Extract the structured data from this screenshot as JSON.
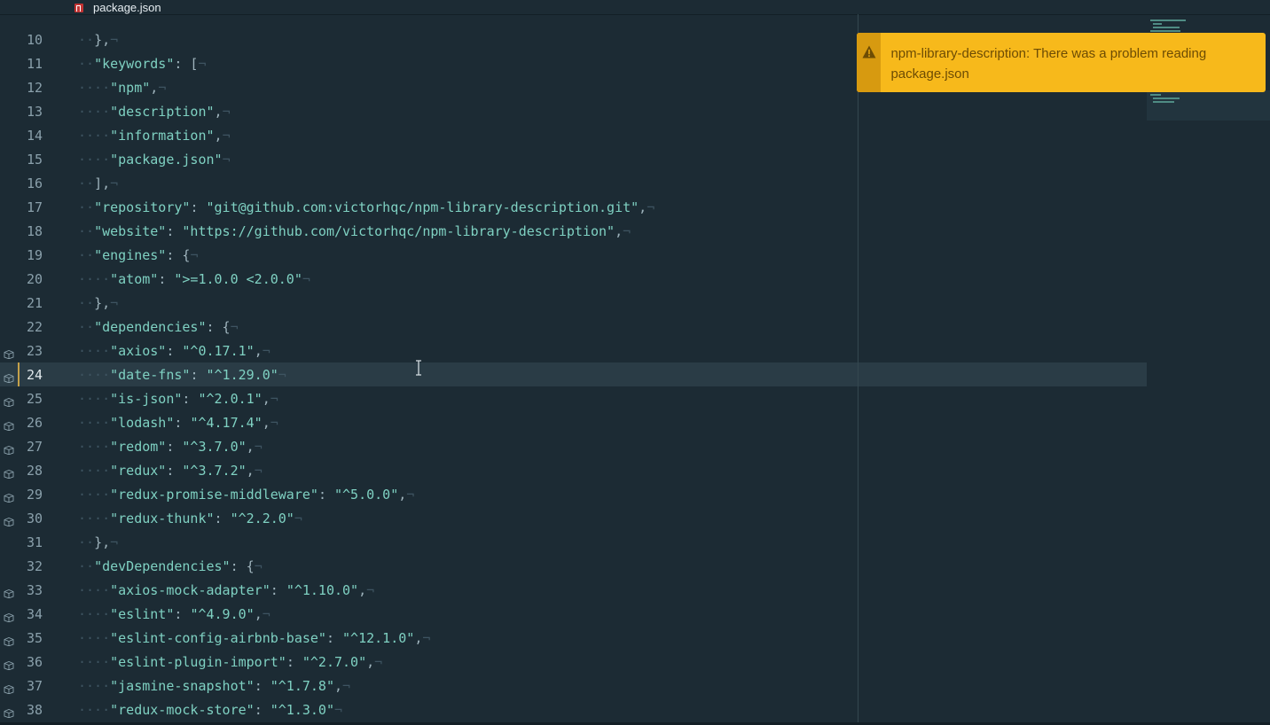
{
  "tab": {
    "title": "package.json",
    "icon": "npm-icon"
  },
  "notification": {
    "type": "warning",
    "icon": "warning-icon",
    "message": "npm-library-description: There was a problem reading package.json",
    "colors": {
      "background": "#f7b91b",
      "strip": "#d79a10",
      "text": "#6d4c04"
    }
  },
  "editor": {
    "active_line": 24,
    "lines": [
      {
        "num": "10",
        "indent": 1,
        "text": "},",
        "dep": false
      },
      {
        "num": "11",
        "indent": 1,
        "text": "\"keywords\": [",
        "dep": false
      },
      {
        "num": "12",
        "indent": 2,
        "text": "\"npm\",",
        "dep": false
      },
      {
        "num": "13",
        "indent": 2,
        "text": "\"description\",",
        "dep": false
      },
      {
        "num": "14",
        "indent": 2,
        "text": "\"information\",",
        "dep": false
      },
      {
        "num": "15",
        "indent": 2,
        "text": "\"package.json\"",
        "dep": false
      },
      {
        "num": "16",
        "indent": 1,
        "text": "],",
        "dep": false
      },
      {
        "num": "17",
        "indent": 1,
        "text": "\"repository\": \"git@github.com:victorhqc/npm-library-description.git\",",
        "dep": false
      },
      {
        "num": "18",
        "indent": 1,
        "text": "\"website\": \"https://github.com/victorhqc/npm-library-description\",",
        "dep": false
      },
      {
        "num": "19",
        "indent": 1,
        "text": "\"engines\": {",
        "dep": false
      },
      {
        "num": "20",
        "indent": 2,
        "text": "\"atom\": \">=1.0.0 <2.0.0\"",
        "dep": false
      },
      {
        "num": "21",
        "indent": 1,
        "text": "},",
        "dep": false
      },
      {
        "num": "22",
        "indent": 1,
        "text": "\"dependencies\": {",
        "dep": false
      },
      {
        "num": "23",
        "indent": 2,
        "text": "\"axios\": \"^0.17.1\",",
        "dep": true
      },
      {
        "num": "24",
        "indent": 2,
        "text": "\"date-fns\": \"^1.29.0\"",
        "dep": true
      },
      {
        "num": "25",
        "indent": 2,
        "text": "\"is-json\": \"^2.0.1\",",
        "dep": true
      },
      {
        "num": "26",
        "indent": 2,
        "text": "\"lodash\": \"^4.17.4\",",
        "dep": true
      },
      {
        "num": "27",
        "indent": 2,
        "text": "\"redom\": \"^3.7.0\",",
        "dep": true
      },
      {
        "num": "28",
        "indent": 2,
        "text": "\"redux\": \"^3.7.2\",",
        "dep": true
      },
      {
        "num": "29",
        "indent": 2,
        "text": "\"redux-promise-middleware\": \"^5.0.0\",",
        "dep": true
      },
      {
        "num": "30",
        "indent": 2,
        "text": "\"redux-thunk\": \"^2.2.0\"",
        "dep": true
      },
      {
        "num": "31",
        "indent": 1,
        "text": "},",
        "dep": false
      },
      {
        "num": "32",
        "indent": 1,
        "text": "\"devDependencies\": {",
        "dep": false
      },
      {
        "num": "33",
        "indent": 2,
        "text": "\"axios-mock-adapter\": \"^1.10.0\",",
        "dep": true
      },
      {
        "num": "34",
        "indent": 2,
        "text": "\"eslint\": \"^4.9.0\",",
        "dep": true
      },
      {
        "num": "35",
        "indent": 2,
        "text": "\"eslint-config-airbnb-base\": \"^12.1.0\",",
        "dep": true
      },
      {
        "num": "36",
        "indent": 2,
        "text": "\"eslint-plugin-import\": \"^2.7.0\",",
        "dep": true
      },
      {
        "num": "37",
        "indent": 2,
        "text": "\"jasmine-snapshot\": \"^1.7.8\",",
        "dep": true
      },
      {
        "num": "38",
        "indent": 2,
        "text": "\"redux-mock-store\": \"^1.3.0\"",
        "dep": true
      }
    ]
  }
}
